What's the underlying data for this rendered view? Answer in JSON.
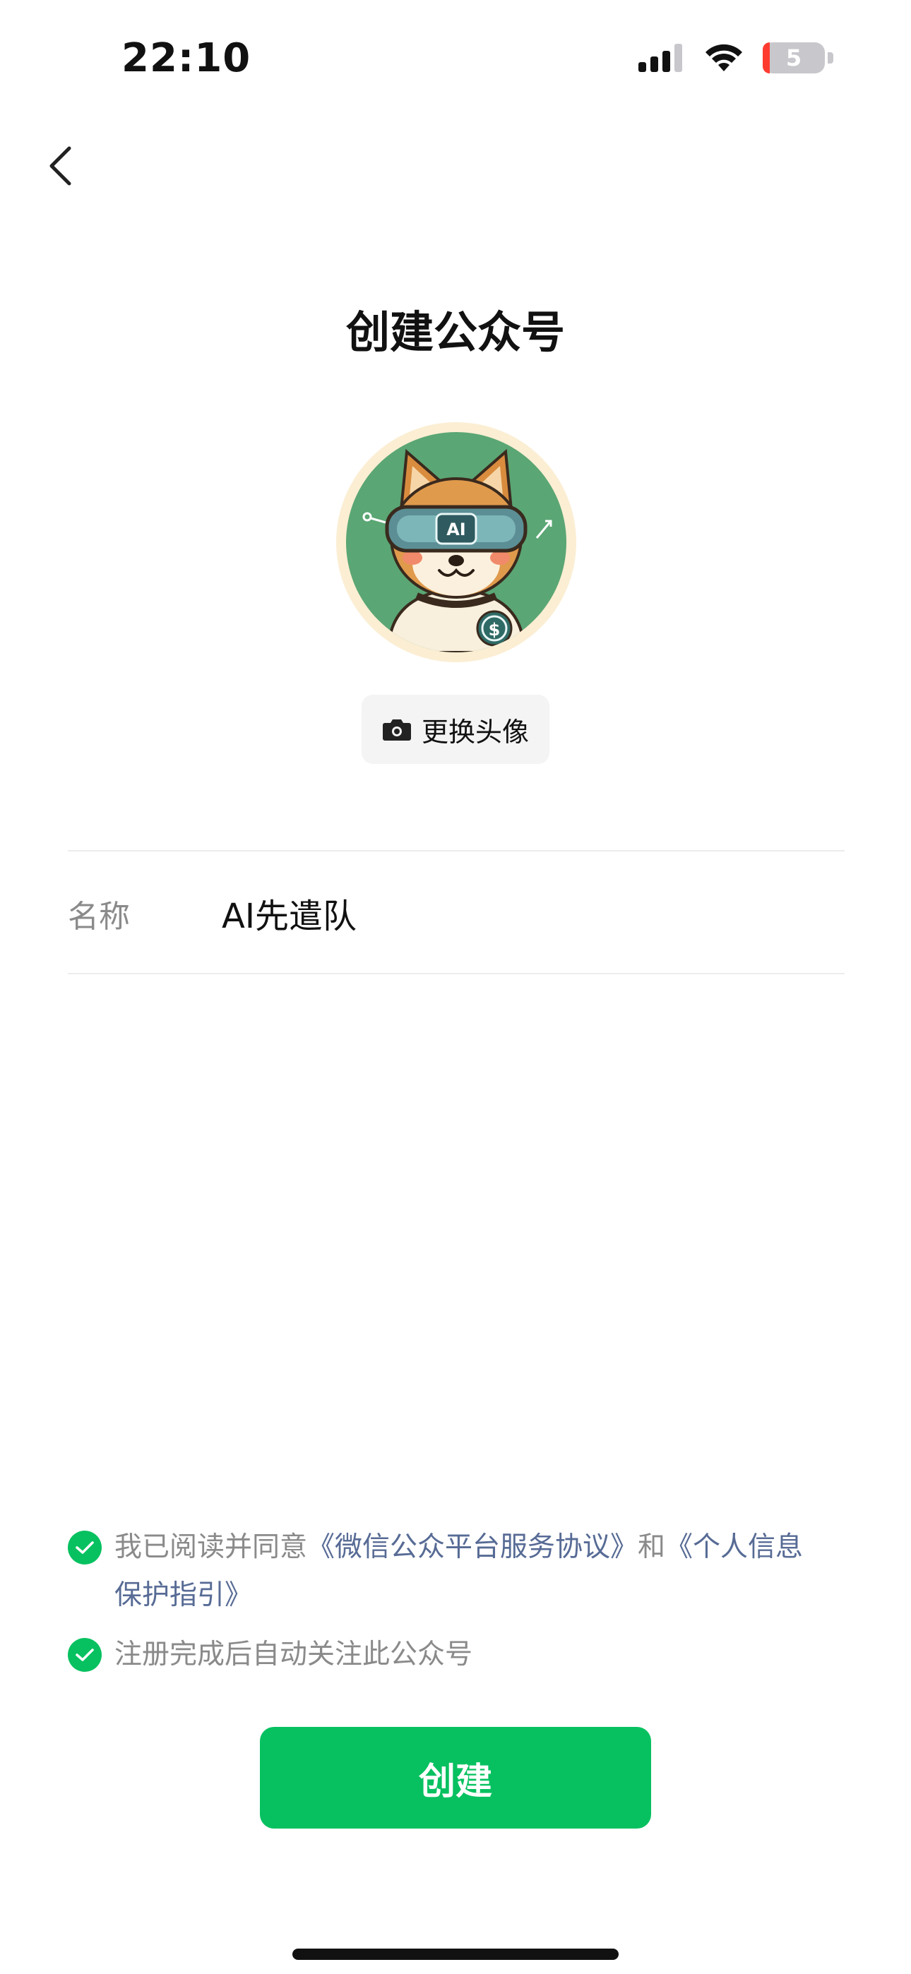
{
  "status_bar": {
    "time": "22:10",
    "battery_level": "5"
  },
  "page": {
    "title": "创建公众号"
  },
  "avatar": {
    "change_label": "更换头像",
    "badge_text": "AI",
    "coin_symbol": "$"
  },
  "form": {
    "name_label": "名称",
    "name_value": "AI先遣队"
  },
  "agreements": {
    "line1_prefix": "我已阅读并同意",
    "service_link": "《微信公众平台服务协议》",
    "conjunction": "和",
    "privacy_link": "《个人信息保护指引》",
    "line2": "注册完成后自动关注此公众号"
  },
  "actions": {
    "create_label": "创建"
  },
  "colors": {
    "accent": "#07c160",
    "link": "#576b95",
    "muted": "#8a8a8a"
  }
}
